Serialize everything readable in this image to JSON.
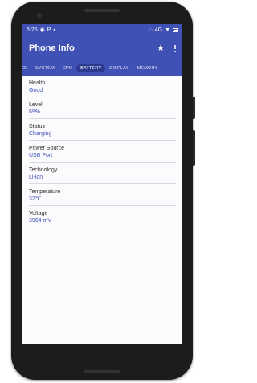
{
  "statusbar": {
    "time": "6:25",
    "left_icons": [
      "whatsapp-icon",
      "parking-icon",
      "notification-icon"
    ],
    "right_icons": [
      "cast-icon",
      "vpn-icon",
      "wifi-icon",
      "battery-icon"
    ],
    "lte_label": "4G"
  },
  "app": {
    "title": "Phone Info",
    "accent_color": "#3f51b5"
  },
  "tabs": [
    {
      "label": "CE"
    },
    {
      "label": "SYSTEM"
    },
    {
      "label": "CPU"
    },
    {
      "label": "BATTERY"
    },
    {
      "label": "DISPLAY"
    },
    {
      "label": "MEMORY"
    }
  ],
  "active_tab": "BATTERY",
  "battery": {
    "rows": [
      {
        "label": "Health",
        "value": "Good"
      },
      {
        "label": "Level",
        "value": "69%"
      },
      {
        "label": "Status",
        "value": "Charging"
      },
      {
        "label": "Power Source",
        "value": "USB Port"
      },
      {
        "label": "Technology",
        "value": "Li-ion"
      },
      {
        "label": "Temperature",
        "value": "32℃"
      },
      {
        "label": "Voltage",
        "value": "3964 mV"
      }
    ]
  }
}
